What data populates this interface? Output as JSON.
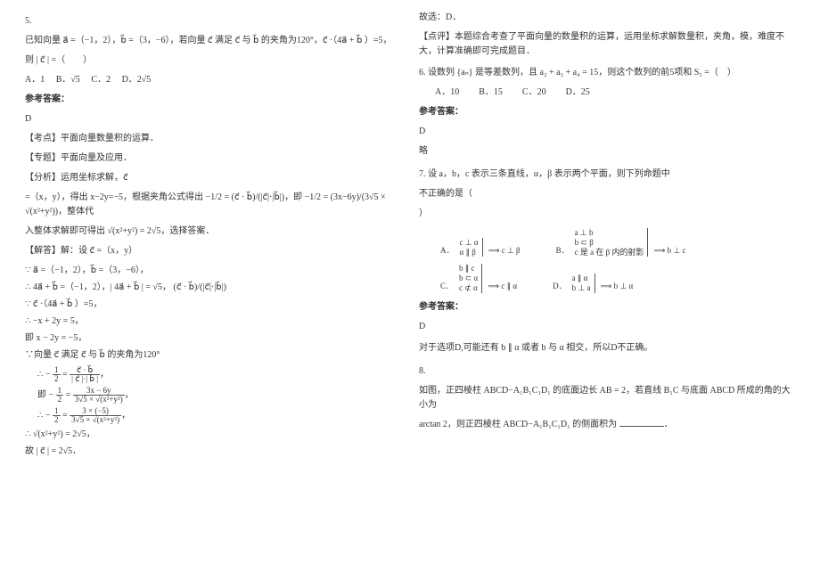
{
  "left": {
    "q5": {
      "num": "5.",
      "stem1": "已知向量 a⃗ =（−1，2），b⃗ =（3，−6），若向量 c⃗ 满足 c⃗ 与 b⃗ 的夹角为120°，c⃗ ·（4a⃗ + b⃗ ）=5，",
      "stem2": "则 | c⃗ | =（　　）",
      "optA": "A．1",
      "optB": "B．√5",
      "optC": "C．2",
      "optD": "D．2√5",
      "ansLabel": "参考答案：",
      "ans": "D",
      "point": "【考点】平面向量数量积的运算．",
      "topic": "【专题】平面向量及应用．",
      "analyze": "【分析】运用坐标求解，c⃗",
      "an1": "=（x，y），得出 x−2y=−5，根据夹角公式得出  −1/2 = (c⃗ · b⃗)/(|c⃗|·|b⃗|)，即  −1/2 = (3x−6y)/(3√5 × √(x²+y²))，整体代",
      "an2": "入整体求解即可得出 √(x²+y²) = 2√5，选择答案．",
      "solve": "【解答】解：设 c⃗ =（x，y）",
      "s1": "∵ a⃗ =（−1，2），b⃗ =（3，−6），",
      "s2": "∴ 4a⃗ + b⃗ =（−1，2），| 4a⃗ + b⃗ | = √5， (c⃗ · b⃗)/(|c⃗|·|b⃗|)",
      "s3": "∵ c⃗ ·（4a⃗ + b⃗ ）=5，",
      "s4": "∴ −x + 2y = 5，",
      "s5": "即 x − 2y = −5，",
      "s6": "∵向量 c⃗ 满足 c⃗ 与 b⃗ 的夹角为120°",
      "s7": "∴ −1/2 = (c⃗ · b⃗)/(|c⃗|·|b⃗|)，",
      "s8": "即 −1/2 = (3x−6y)/(3√5 × √(x²+y²))，",
      "s9": "∴ −1/2 = (3×(−5))/(3√5 × √(x²+y²))，",
      "s10": "∴ √(x²+y²) = 2√5，",
      "s11": "故 | c⃗ | = 2√5．"
    }
  },
  "right": {
    "r1": "故选：D．",
    "r2": "【点评】本题综合考查了平面向量的数量积的运算，运用坐标求解数量积，夹角，模，难度不大，计算准确即可完成题目．",
    "q6": {
      "stem": "6. 设数列 {aₙ} 是等差数列，且 a₂ + a₃ + a₄ = 15，则这个数列的前5项和 S₅ =（　）",
      "optA": "A．10",
      "optB": "B．15",
      "optC": "C．20",
      "optD": "D．25",
      "ansLabel": "参考答案：",
      "ans": "D",
      "brief": "略"
    },
    "q7": {
      "stem1": "7. 设 a，b，c 表示三条直线，α，β 表示两个平面，则下列命题中",
      "stem2": "不正确的是（",
      "stem3": "）",
      "A": {
        "label": "A．",
        "l1": "c ⊥ α",
        "l2": "α ∥ β",
        "r": "⟹ c ⊥ β"
      },
      "B": {
        "label": "B．",
        "l1": "a ⊥ b",
        "l2": "b ⊂ β",
        "l3": "c 是 a 在 β 内的射影",
        "r": "⟹ b ⊥ c"
      },
      "C": {
        "label": "C．",
        "l1": "b ∥ c",
        "l2": "b ⊂ α",
        "l3": "c ⊄ α",
        "r": "⟹ c ∥ α"
      },
      "D": {
        "label": "D．",
        "l1": "a ∥ α",
        "l2": "b ⊥ a",
        "r": "⟹ b ⊥ α"
      },
      "ansLabel": "参考答案：",
      "ans": "D",
      "expl": "对于选项D,可能还有 b ∥ α 或者 b 与 α 相交，所以D不正确。"
    },
    "q8": {
      "num": "8.",
      "stem1": "如图，正四棱柱 ABCD−A₁B₁C₁D₁ 的底面边长 AB = 2，若直线 B₁C 与底面 ABCD 所成的角的大小为",
      "stem2": "arctan 2，则正四棱柱 ABCD−A₁B₁C₁D₁ 的侧面积为",
      "blank": "＿＿＿＿．"
    }
  }
}
